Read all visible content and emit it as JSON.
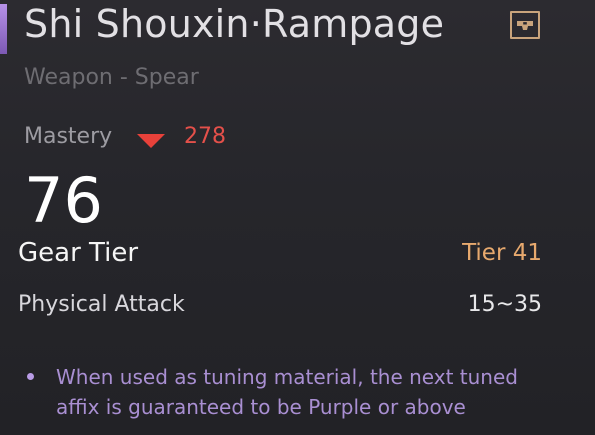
{
  "item": {
    "name": "Shi Shouxin·Rampage",
    "type_line": "Weapon - Spear",
    "mastery": {
      "label": "Mastery",
      "value": "278",
      "trend": "down"
    },
    "score": "76",
    "gear_tier": {
      "label": "Gear Tier",
      "value": "Tier 41"
    },
    "stats": [
      {
        "label": "Physical Attack",
        "value": "15~35"
      }
    ],
    "effect": "When used as tuning material, the next tuned affix is guaranteed to be Purple or above"
  },
  "icons": {
    "lock": "lock-icon",
    "mastery_trend": "down-triangle-icon",
    "effect_bullet": "bullet-icon"
  },
  "colors": {
    "rarity_accent": "#a77fe0",
    "mastery_down": "#e8413a",
    "tier": "#e7a96e",
    "effect_text": "#a98fd2"
  }
}
